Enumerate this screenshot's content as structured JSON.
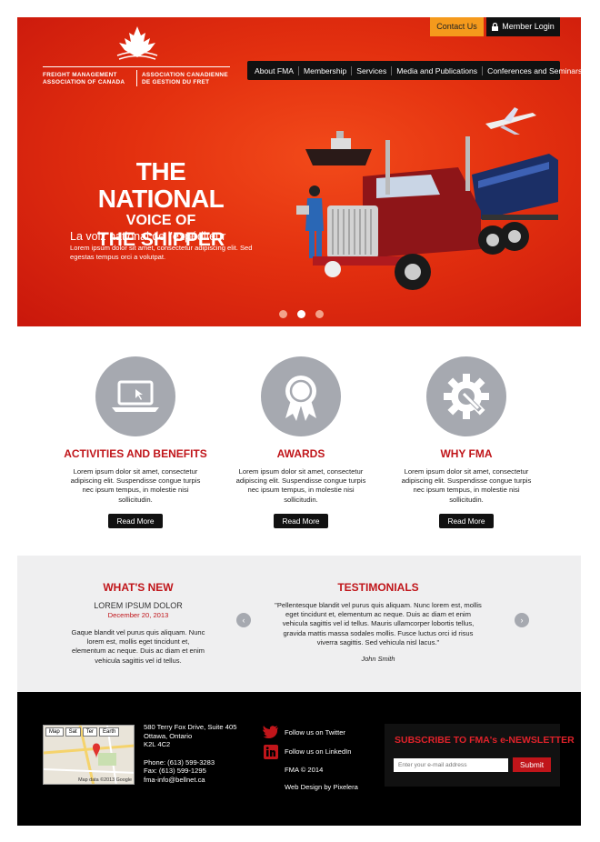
{
  "header": {
    "contact_label": "Contact Us",
    "login_label": "Member Login",
    "logo": {
      "name_en": "FREIGHT MANAGEMENT\nASSOCIATION OF CANADA",
      "name_fr": "ASSOCIATION CANADIENNE\nDE GESTION DU FRET"
    },
    "nav": [
      {
        "label": "About FMA"
      },
      {
        "label": "Membership"
      },
      {
        "label": "Services"
      },
      {
        "label": "Media and Publications"
      },
      {
        "label": "Conferences and Seminars"
      }
    ]
  },
  "hero": {
    "headline_1": "THE NATIONAL",
    "headline_2": "VOICE OF",
    "headline_3": "THE SHIPPER",
    "tagline_fr": "La voiz national de l'expéditeur",
    "tagline_sub": "Lorem ipsum dolor sit amet, consectetur adipiscing elit. Sed egestas tempus orci a volutpat.",
    "slides": 3,
    "active_slide": 2
  },
  "features": [
    {
      "icon": "laptop-icon",
      "title": "ACTIVITIES AND BENEFITS",
      "text": "Lorem ipsum dolor sit amet, consectetur adipiscing elit. Suspendisse congue turpis nec ipsum tempus, in molestie nisi sollicitudin.",
      "button": "Read More"
    },
    {
      "icon": "award-ribbon-icon",
      "title": "AWARDS",
      "text": "Lorem ipsum dolor sit amet, consectetur adipiscing elit. Suspendisse congue turpis nec ipsum tempus, in molestie nisi sollicitudin.",
      "button": "Read More"
    },
    {
      "icon": "gear-wrench-icon",
      "title": "WHY FMA",
      "text": "Lorem ipsum dolor sit amet, consectetur adipiscing elit. Suspendisse congue turpis nec ipsum tempus, in molestie nisi sollicitudin.",
      "button": "Read More"
    }
  ],
  "whats_new": {
    "title": "WHAT'S NEW",
    "item_title": "LOREM IPSUM DOLOR",
    "date": "December 20, 2013",
    "text": "Gaque blandit vel purus quis aliquam. Nunc lorem est, mollis eget tincidunt et, elementum ac neque. Duis ac diam et enim vehicula sagittis vel id tellus."
  },
  "testimonials": {
    "title": "TESTIMONIALS",
    "quote": "\"Pellentesque blandit vel purus quis aliquam. Nunc lorem est, mollis eget tincidunt et, elementum ac neque. Duis ac diam et enim vehicula sagittis vel id tellus. Mauris ullamcorper lobortis tellus, gravida mattis massa sodales mollis. Fusce luctus orci id risus viverra sagittis. Sed vehicula nisl lacus.\"",
    "author": "John Smith",
    "prev": "‹",
    "next": "›"
  },
  "footer": {
    "map": {
      "tabs": [
        "Map",
        "Sat",
        "Ter",
        "Earth"
      ],
      "credit": "Map data ©2013 Google"
    },
    "address_1": "580 Terry Fox Drive, Suite 405",
    "address_2": "Ottawa, Ontario",
    "address_3": "K2L 4C2",
    "phone": "Phone: (613) 599-3283",
    "fax": "Fax: (613) 599-1295",
    "email": "fma-info@bellnet.ca",
    "twitter_label": "Follow us on Twitter",
    "linkedin_label": "Follow us on LinkedIn",
    "copyright": "FMA © 2014",
    "credit": "Web Design by Pixelera",
    "newsletter": {
      "title": "SUBSCRIBE TO FMA's e-NEWSLETTER",
      "placeholder": "Enter your e-mail address",
      "submit": "Submit"
    }
  },
  "colors": {
    "brand_red": "#c0151a",
    "hero_red": "#e3300f",
    "accent_orange": "#f59a1c",
    "footer_bg": "#000000",
    "icon_grey": "#a6a9b0"
  }
}
